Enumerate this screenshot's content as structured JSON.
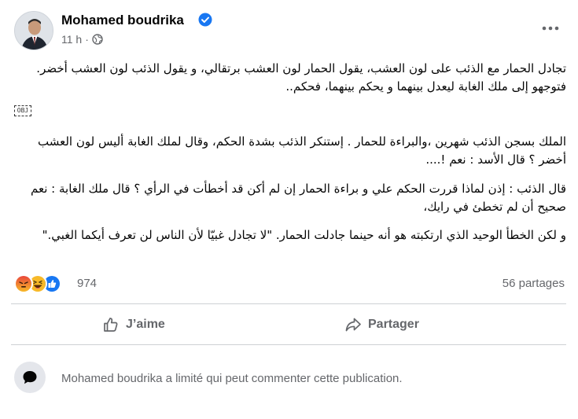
{
  "post": {
    "author": "Mohamed boudrika",
    "time": "11 h",
    "separator": "·",
    "paragraphs": [
      "تجادل الحمار مع الذئب على لون العشب، يقول الحمار لون العشب برتقالي، و يقول الذئب لون العشب أخضر. فتوجهو إلى ملك الغابة ليعدل بينهما و يحكم بينهما، فحكم..",
      "الملك بسجن الذئب شهرين ،والبراءة للحمار . إستنكر الذئب بشدة الحكم، وقال لملك الغابة أليس لون العشب أخضر ؟ قال الأسد : نعم !....",
      "قال الذئب : إذن لماذا قررت الحكم علي و براءة الحمار إن لم أكن قد أخطأت في الرأي ؟ قال ملك الغابة : نعم صحيح أن لم تخطئ في رايك،",
      "و لكن الخطأ الوحيد الذي ارتكبته هو أنه حينما جادلت الحمار. \"لا تجادل غبيّا لأن الناس لن تعرف أيكما الغبي.\""
    ],
    "obj_placeholder": "OBJ"
  },
  "stats": {
    "reaction_count": "974",
    "shares": "56 partages"
  },
  "actions": {
    "like_label": "J’aime",
    "share_label": "Partager"
  },
  "comment_notice": "Mohamed boudrika a limité qui peut commenter cette publication.",
  "colors": {
    "verified": "#1877f2",
    "like_blue": "#1877f2",
    "haha_yellow": "#f7b928",
    "angry_orange": "#e9710f",
    "secondary_text": "#65676b"
  }
}
